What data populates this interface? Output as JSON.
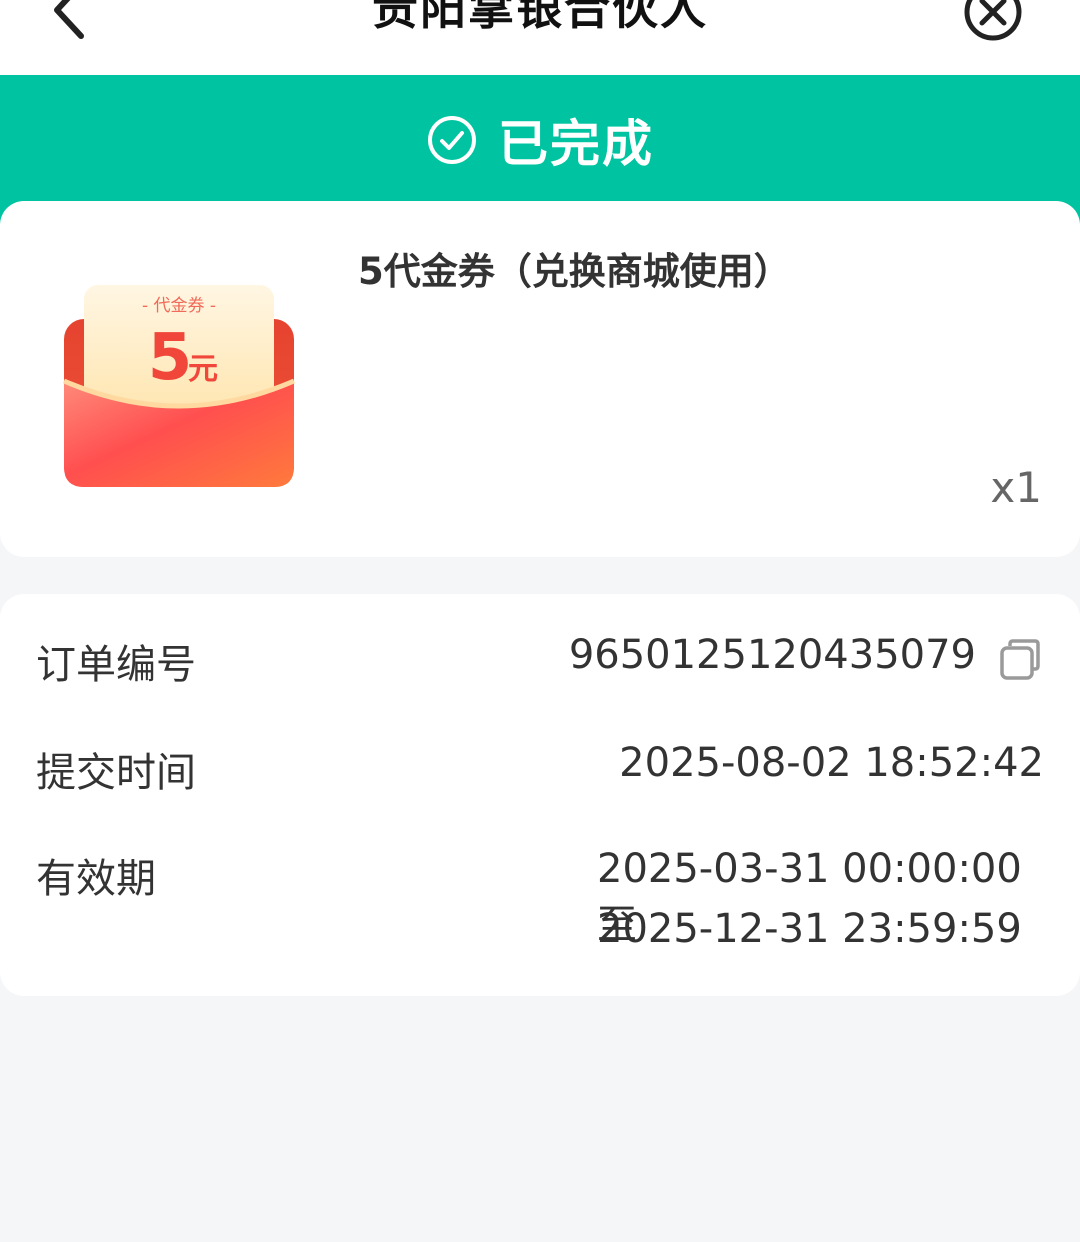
{
  "header": {
    "title": "贵阳掌银合伙人",
    "back_icon": "chevron-left-icon",
    "close_icon": "close-circle-icon"
  },
  "status": {
    "label": "已完成",
    "icon": "check-circle-icon",
    "color": "#00c4a1"
  },
  "product": {
    "name": "5代金券（兑换商城使用）",
    "quantity": "x1",
    "coupon": {
      "tag": "- 代金券 -",
      "amount": "5",
      "unit": "元"
    }
  },
  "order_info": {
    "order_no_label": "订单编号",
    "order_no_value": "9650125120435079",
    "submit_time_label": "提交时间",
    "submit_time_value": "2025-08-02 18:52:42",
    "validity_label": "有效期",
    "validity_line1": "2025-03-31 00:00:00 至",
    "validity_line2": "2025-12-31 23:59:59"
  }
}
